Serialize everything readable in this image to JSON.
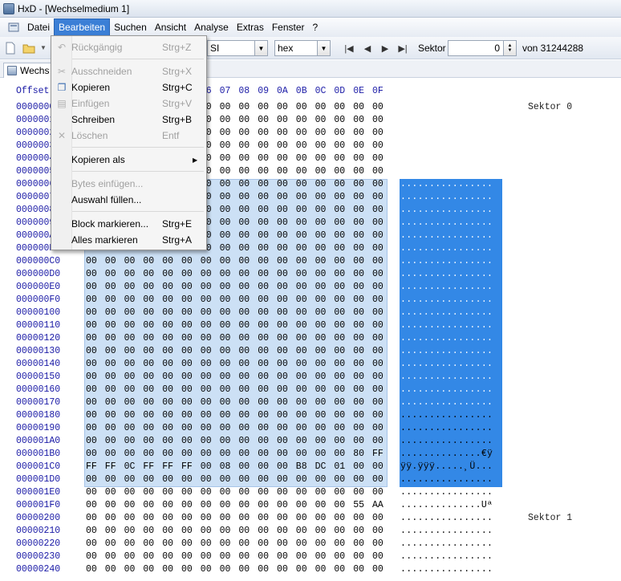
{
  "window": {
    "title": "HxD - [Wechselmedium 1]"
  },
  "menubar": {
    "items": [
      "Datei",
      "Bearbeiten",
      "Suchen",
      "Ansicht",
      "Analyse",
      "Extras",
      "Fenster",
      "?"
    ],
    "active": "Bearbeiten"
  },
  "toolbar": {
    "charset_value": "ANSI",
    "charset_visible": "SI",
    "offset_base": "hex",
    "sector_label": "Sektor",
    "sector_value": "0",
    "sector_total": "von 31244288"
  },
  "tab": {
    "label": "Wechs"
  },
  "editor": {
    "offset_header": "Offset",
    "column_headers": [
      "00",
      "01",
      "02",
      "03",
      "04",
      "05",
      "06",
      "07",
      "08",
      "09",
      "0A",
      "0B",
      "0C",
      "0D",
      "0E",
      "0F"
    ],
    "visible_column_headers": [
      "6",
      "07",
      "08",
      "09",
      "0A",
      "0B",
      "0C",
      "0D",
      "0E",
      "0F"
    ],
    "rows": [
      {
        "off": "00000000",
        "hex": [
          "00",
          "00",
          "00",
          "00",
          "00",
          "00",
          "00",
          "00",
          "00",
          "00",
          "00",
          "00",
          "00",
          "00",
          "00",
          "00"
        ],
        "asc": "................",
        "sel": true
      },
      {
        "off": "00000010",
        "hex": [
          "00",
          "00",
          "00",
          "00",
          "00",
          "00",
          "00",
          "00",
          "00",
          "00",
          "00",
          "00",
          "00",
          "00",
          "00",
          "00"
        ],
        "asc": "................",
        "sel": true
      },
      {
        "off": "00000020",
        "hex": [
          "00",
          "00",
          "00",
          "00",
          "00",
          "00",
          "00",
          "00",
          "00",
          "00",
          "00",
          "00",
          "00",
          "00",
          "00",
          "00"
        ],
        "asc": "................",
        "sel": true
      },
      {
        "off": "00000030",
        "hex": [
          "00",
          "00",
          "00",
          "00",
          "00",
          "00",
          "00",
          "00",
          "00",
          "00",
          "00",
          "00",
          "00",
          "00",
          "00",
          "00"
        ],
        "asc": "................",
        "sel": true
      },
      {
        "off": "00000040",
        "hex": [
          "00",
          "00",
          "00",
          "00",
          "00",
          "00",
          "00",
          "00",
          "00",
          "00",
          "00",
          "00",
          "00",
          "00",
          "00",
          "00"
        ],
        "asc": "................",
        "sel": true
      },
      {
        "off": "00000050",
        "hex": [
          "00",
          "00",
          "00",
          "00",
          "00",
          "00",
          "00",
          "00",
          "00",
          "00",
          "00",
          "00",
          "00",
          "00",
          "00",
          "00"
        ],
        "asc": "................",
        "sel": true
      },
      {
        "off": "00000060",
        "hex": [
          "00",
          "00",
          "00",
          "00",
          "00",
          "00",
          "00",
          "00",
          "00",
          "00",
          "00",
          "00",
          "00",
          "00",
          "00",
          "00"
        ],
        "asc": "................",
        "sel": true
      },
      {
        "off": "00000070",
        "hex": [
          "00",
          "00",
          "00",
          "00",
          "00",
          "00",
          "00",
          "00",
          "00",
          "00",
          "00",
          "00",
          "00",
          "00",
          "00",
          "00"
        ],
        "asc": "................",
        "sel": true
      },
      {
        "off": "00000080",
        "hex": [
          "00",
          "00",
          "00",
          "00",
          "00",
          "00",
          "00",
          "00",
          "00",
          "00",
          "00",
          "00",
          "00",
          "00",
          "00",
          "00"
        ],
        "asc": "................",
        "sel": true
      },
      {
        "off": "00000090",
        "hex": [
          "00",
          "00",
          "00",
          "00",
          "00",
          "00",
          "00",
          "00",
          "00",
          "00",
          "00",
          "00",
          "00",
          "00",
          "00",
          "00"
        ],
        "asc": "................",
        "sel": true
      },
      {
        "off": "000000A0",
        "hex": [
          "00",
          "00",
          "00",
          "00",
          "00",
          "00",
          "00",
          "00",
          "00",
          "00",
          "00",
          "00",
          "00",
          "00",
          "00",
          "00"
        ],
        "asc": "................",
        "sel": true
      },
      {
        "off": "000000B0",
        "hex": [
          "00",
          "00",
          "00",
          "00",
          "00",
          "00",
          "00",
          "00",
          "00",
          "00",
          "00",
          "00",
          "00",
          "00",
          "00",
          "00"
        ],
        "asc": "................",
        "sel": true
      },
      {
        "off": "000000C0",
        "hex": [
          "00",
          "00",
          "00",
          "00",
          "00",
          "00",
          "00",
          "00",
          "00",
          "00",
          "00",
          "00",
          "00",
          "00",
          "00",
          "00"
        ],
        "asc": "................",
        "sel": true
      },
      {
        "off": "000000D0",
        "hex": [
          "00",
          "00",
          "00",
          "00",
          "00",
          "00",
          "00",
          "00",
          "00",
          "00",
          "00",
          "00",
          "00",
          "00",
          "00",
          "00"
        ],
        "asc": "................",
        "sel": true
      },
      {
        "off": "000000E0",
        "hex": [
          "00",
          "00",
          "00",
          "00",
          "00",
          "00",
          "00",
          "00",
          "00",
          "00",
          "00",
          "00",
          "00",
          "00",
          "00",
          "00"
        ],
        "asc": "................",
        "sel": true
      },
      {
        "off": "000000F0",
        "hex": [
          "00",
          "00",
          "00",
          "00",
          "00",
          "00",
          "00",
          "00",
          "00",
          "00",
          "00",
          "00",
          "00",
          "00",
          "00",
          "00"
        ],
        "asc": "................",
        "sel": true
      },
      {
        "off": "00000100",
        "hex": [
          "00",
          "00",
          "00",
          "00",
          "00",
          "00",
          "00",
          "00",
          "00",
          "00",
          "00",
          "00",
          "00",
          "00",
          "00",
          "00"
        ],
        "asc": "................",
        "sel": true
      },
      {
        "off": "00000110",
        "hex": [
          "00",
          "00",
          "00",
          "00",
          "00",
          "00",
          "00",
          "00",
          "00",
          "00",
          "00",
          "00",
          "00",
          "00",
          "00",
          "00"
        ],
        "asc": "................",
        "sel": true
      },
      {
        "off": "00000120",
        "hex": [
          "00",
          "00",
          "00",
          "00",
          "00",
          "00",
          "00",
          "00",
          "00",
          "00",
          "00",
          "00",
          "00",
          "00",
          "00",
          "00"
        ],
        "asc": "................",
        "sel": true
      },
      {
        "off": "00000130",
        "hex": [
          "00",
          "00",
          "00",
          "00",
          "00",
          "00",
          "00",
          "00",
          "00",
          "00",
          "00",
          "00",
          "00",
          "00",
          "00",
          "00"
        ],
        "asc": "................",
        "sel": true
      },
      {
        "off": "00000140",
        "hex": [
          "00",
          "00",
          "00",
          "00",
          "00",
          "00",
          "00",
          "00",
          "00",
          "00",
          "00",
          "00",
          "00",
          "00",
          "00",
          "00"
        ],
        "asc": "................",
        "sel": true
      },
      {
        "off": "00000150",
        "hex": [
          "00",
          "00",
          "00",
          "00",
          "00",
          "00",
          "00",
          "00",
          "00",
          "00",
          "00",
          "00",
          "00",
          "00",
          "00",
          "00"
        ],
        "asc": "................",
        "sel": true
      },
      {
        "off": "00000160",
        "hex": [
          "00",
          "00",
          "00",
          "00",
          "00",
          "00",
          "00",
          "00",
          "00",
          "00",
          "00",
          "00",
          "00",
          "00",
          "00",
          "00"
        ],
        "asc": "................",
        "sel": true
      },
      {
        "off": "00000170",
        "hex": [
          "00",
          "00",
          "00",
          "00",
          "00",
          "00",
          "00",
          "00",
          "00",
          "00",
          "00",
          "00",
          "00",
          "00",
          "00",
          "00"
        ],
        "asc": "................",
        "sel": true
      },
      {
        "off": "00000180",
        "hex": [
          "00",
          "00",
          "00",
          "00",
          "00",
          "00",
          "00",
          "00",
          "00",
          "00",
          "00",
          "00",
          "00",
          "00",
          "00",
          "00"
        ],
        "asc": "................"
      },
      {
        "off": "00000190",
        "hex": [
          "00",
          "00",
          "00",
          "00",
          "00",
          "00",
          "00",
          "00",
          "00",
          "00",
          "00",
          "00",
          "00",
          "00",
          "00",
          "00"
        ],
        "asc": "................"
      },
      {
        "off": "000001A0",
        "hex": [
          "00",
          "00",
          "00",
          "00",
          "00",
          "00",
          "00",
          "00",
          "00",
          "00",
          "00",
          "00",
          "00",
          "00",
          "00",
          "00"
        ],
        "asc": "................"
      },
      {
        "off": "000001B0",
        "hex": [
          "00",
          "00",
          "00",
          "00",
          "00",
          "00",
          "00",
          "00",
          "00",
          "00",
          "00",
          "00",
          "00",
          "00",
          "80",
          "FF"
        ],
        "asc": "..............€ÿ"
      },
      {
        "off": "000001C0",
        "hex": [
          "FF",
          "FF",
          "0C",
          "FF",
          "FF",
          "FF",
          "00",
          "08",
          "00",
          "00",
          "00",
          "B8",
          "DC",
          "01",
          "00",
          "00"
        ],
        "asc": "ÿÿ.ÿÿÿ.....¸Ü..."
      },
      {
        "off": "000001D0",
        "hex": [
          "00",
          "00",
          "00",
          "00",
          "00",
          "00",
          "00",
          "00",
          "00",
          "00",
          "00",
          "00",
          "00",
          "00",
          "00",
          "00"
        ],
        "asc": "................"
      },
      {
        "off": "000001E0",
        "hex": [
          "00",
          "00",
          "00",
          "00",
          "00",
          "00",
          "00",
          "00",
          "00",
          "00",
          "00",
          "00",
          "00",
          "00",
          "00",
          "00"
        ],
        "asc": "................"
      },
      {
        "off": "000001F0",
        "hex": [
          "00",
          "00",
          "00",
          "00",
          "00",
          "00",
          "00",
          "00",
          "00",
          "00",
          "00",
          "00",
          "00",
          "00",
          "55",
          "AA"
        ],
        "asc": "..............Uª"
      },
      {
        "off": "00000200",
        "hex": [
          "00",
          "00",
          "00",
          "00",
          "00",
          "00",
          "00",
          "00",
          "00",
          "00",
          "00",
          "00",
          "00",
          "00",
          "00",
          "00"
        ],
        "asc": "................"
      },
      {
        "off": "00000210",
        "hex": [
          "00",
          "00",
          "00",
          "00",
          "00",
          "00",
          "00",
          "00",
          "00",
          "00",
          "00",
          "00",
          "00",
          "00",
          "00",
          "00"
        ],
        "asc": "................"
      },
      {
        "off": "00000220",
        "hex": [
          "00",
          "00",
          "00",
          "00",
          "00",
          "00",
          "00",
          "00",
          "00",
          "00",
          "00",
          "00",
          "00",
          "00",
          "00",
          "00"
        ],
        "asc": "................"
      },
      {
        "off": "00000230",
        "hex": [
          "00",
          "00",
          "00",
          "00",
          "00",
          "00",
          "00",
          "00",
          "00",
          "00",
          "00",
          "00",
          "00",
          "00",
          "00",
          "00"
        ],
        "asc": "................"
      },
      {
        "off": "00000240",
        "hex": [
          "00",
          "00",
          "00",
          "00",
          "00",
          "00",
          "00",
          "00",
          "00",
          "00",
          "00",
          "00",
          "00",
          "00",
          "00",
          "00"
        ],
        "asc": "................"
      }
    ],
    "sector_labels": [
      {
        "label": "Sektor 0"
      },
      {
        "label": "Sektor 1"
      }
    ]
  },
  "edit_menu": {
    "items": [
      {
        "label": "Rückgängig",
        "shortcut": "Strg+Z",
        "disabled": true,
        "icon": "undo-icon"
      },
      {
        "sep": true
      },
      {
        "label": "Ausschneiden",
        "shortcut": "Strg+X",
        "disabled": true,
        "icon": "cut-icon"
      },
      {
        "label": "Kopieren",
        "shortcut": "Strg+C",
        "disabled": false,
        "icon": "copy-icon"
      },
      {
        "label": "Einfügen",
        "shortcut": "Strg+V",
        "disabled": true,
        "icon": "paste-icon"
      },
      {
        "label": "Schreiben",
        "shortcut": "Strg+B",
        "disabled": false
      },
      {
        "label": "Löschen",
        "shortcut": "Entf",
        "disabled": true,
        "icon": "delete-icon"
      },
      {
        "sep": true
      },
      {
        "label": "Kopieren als",
        "shortcut": "",
        "disabled": false,
        "submenu": true
      },
      {
        "sep": true
      },
      {
        "label": "Bytes einfügen...",
        "shortcut": "",
        "disabled": true
      },
      {
        "label": "Auswahl füllen...",
        "shortcut": "",
        "disabled": false
      },
      {
        "sep": true
      },
      {
        "label": "Block markieren...",
        "shortcut": "Strg+E",
        "disabled": false
      },
      {
        "label": "Alles markieren",
        "shortcut": "Strg+A",
        "disabled": false
      }
    ]
  },
  "colors": {
    "selection_hex_bg": "#cce0f5",
    "selection_ascii_bg": "#3388e6",
    "offset_text": "#1a1aa6",
    "menu_active": "#3b7fd6"
  }
}
